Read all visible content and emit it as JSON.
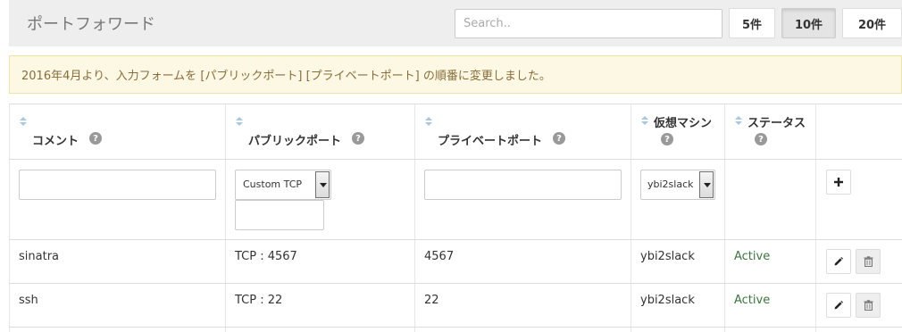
{
  "header": {
    "title": "ポートフォワード",
    "search": {
      "placeholder": "Search..",
      "value": ""
    },
    "per_page_options": [
      {
        "label": "5件",
        "active": false
      },
      {
        "label": "10件",
        "active": true
      },
      {
        "label": "20件",
        "active": false
      }
    ]
  },
  "notice": {
    "text": "2016年4月より、入力フォームを [パブリックポート] [プライベートポート] の順番に変更しました。"
  },
  "table": {
    "columns": [
      {
        "label": "コメント",
        "sortable": true,
        "help": true
      },
      {
        "label": "パブリックポート",
        "sortable": true,
        "help": true
      },
      {
        "label": "プライベートポート",
        "sortable": true,
        "help": true
      },
      {
        "label": "仮想マシン",
        "sortable": true,
        "help": true
      },
      {
        "label": "ステータス",
        "sortable": true,
        "help": true
      },
      {
        "label": "",
        "sortable": false,
        "help": false
      }
    ],
    "help_glyph": "?",
    "add_row": {
      "comment_value": "",
      "protocol_selected": "Custom TCP",
      "public_port_value": "",
      "private_port_value": "",
      "vm_selected": "ybi2slack"
    },
    "rows": [
      {
        "comment": "sinatra",
        "public_port": "TCP : 4567",
        "private_port": "4567",
        "vm": "ybi2slack",
        "status": "Active"
      },
      {
        "comment": "ssh",
        "public_port": "TCP : 22",
        "private_port": "22",
        "vm": "ybi2slack",
        "status": "Active"
      }
    ]
  },
  "icons": {
    "sort": "sort-icon",
    "help": "help-circle-icon",
    "add": "plus-icon",
    "edit": "pencil-icon",
    "delete": "trash-icon",
    "dropdown": "chevron-down-icon"
  },
  "colors": {
    "header_bg": "#eeeeee",
    "notice_bg": "#fcf8e3",
    "notice_text": "#8a6d3b",
    "sort_arrow": "#a8c7e0",
    "help_icon": "#999999",
    "status_active": "#3c763d"
  }
}
